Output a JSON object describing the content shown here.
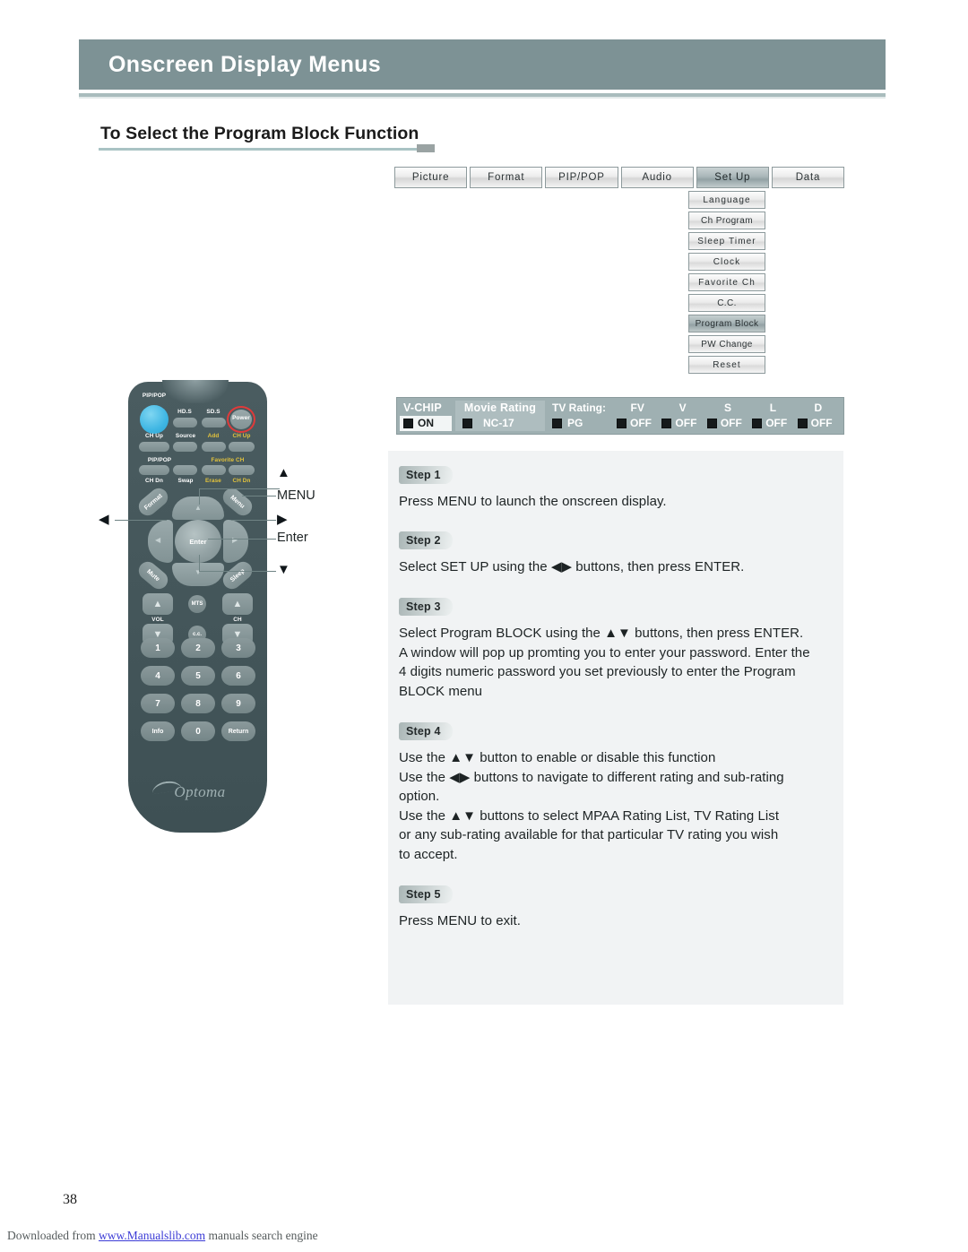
{
  "page": {
    "header_title": "Onscreen Display Menus",
    "section_title": "To Select the Program Block Function",
    "page_number": "38",
    "footer_prefix": "Downloaded from ",
    "footer_link": "www.Manualslib.com",
    "footer_suffix": " manuals search engine"
  },
  "osd": {
    "tabs": [
      {
        "label": "Picture",
        "selected": false
      },
      {
        "label": "Format",
        "selected": false
      },
      {
        "label": "PIP/POP",
        "selected": false
      },
      {
        "label": "Audio",
        "selected": false
      },
      {
        "label": "Set Up",
        "selected": true
      },
      {
        "label": "Data",
        "selected": false
      }
    ],
    "submenu": [
      {
        "label": "Language",
        "selected": false
      },
      {
        "label": "Ch Program",
        "selected": false
      },
      {
        "label": "Sleep Timer",
        "selected": false
      },
      {
        "label": "Clock",
        "selected": false
      },
      {
        "label": "Favorite Ch",
        "selected": false
      },
      {
        "label": "C.C.",
        "selected": false
      },
      {
        "label": "Program Block",
        "selected": true
      },
      {
        "label": "PW Change",
        "selected": false
      },
      {
        "label": "Reset",
        "selected": false
      }
    ]
  },
  "vchip": {
    "vchip_label": "V-CHIP",
    "vchip_value": "ON",
    "movie_label": "Movie Rating",
    "movie_value": "NC-17",
    "tv_label": "TV Rating:",
    "tv_first_value": "PG",
    "tv_columns": [
      "FV",
      "V",
      "S",
      "L",
      "D"
    ],
    "tv_values": [
      "OFF",
      "OFF",
      "OFF",
      "OFF",
      "OFF"
    ]
  },
  "steps": [
    {
      "badge": "Step 1",
      "lines": [
        "Press MENU to launch the onscreen display."
      ]
    },
    {
      "badge": "Step 2",
      "lines": [
        "Select SET UP using the ◀▶ buttons, then press ENTER."
      ]
    },
    {
      "badge": "Step 3",
      "lines": [
        "Select  Program BLOCK using the ▲▼ buttons, then press ENTER.",
        "A window will pop up promting you to enter your password. Enter the",
        "4 digits numeric password you set previously to enter the Program",
        "BLOCK menu"
      ]
    },
    {
      "badge": "Step 4",
      "lines": [
        "Use the ▲▼ button to enable or disable this function",
        "Use the ◀▶ buttons to navigate to different rating and sub-rating",
        "option.",
        "Use the ▲▼ buttons to select  MPAA Rating List, TV Rating List",
        "or any sub-rating available for that particular TV rating you wish",
        "to accept."
      ]
    },
    {
      "badge": "Step 5",
      "lines": [
        "Press MENU to exit."
      ]
    }
  ],
  "remote": {
    "brand": "Optoma",
    "top_labels": {
      "pip_pop_top": "PIP/POP",
      "hds": "HD.S",
      "sds": "SD.S",
      "power": "Power",
      "ch_up_left": "CH Up",
      "source": "Source",
      "add": "Add",
      "ch_up_right": "CH Up",
      "pip_pop_mid": "PIP/POP",
      "favorite_ch": "Favorite CH",
      "ch_dn_left": "CH Dn",
      "swap": "Swap",
      "erase": "Erase",
      "ch_dn_right": "CH Dn"
    },
    "nav": {
      "format": "Format",
      "menu": "Menu",
      "mute": "Mute",
      "sleep": "Sleep",
      "enter": "Enter"
    },
    "keypad": {
      "vol": "VOL",
      "ch": "CH",
      "mts": "MTS",
      "cc": "c.c.",
      "digits": [
        "1",
        "2",
        "3",
        "4",
        "5",
        "6",
        "7",
        "8",
        "9"
      ],
      "info": "Info",
      "zero": "0",
      "return": "Return"
    }
  },
  "callouts": {
    "up": "▲",
    "menu": "MENU",
    "left": "◀",
    "right": "▶",
    "enter": "Enter",
    "down": "▼"
  }
}
